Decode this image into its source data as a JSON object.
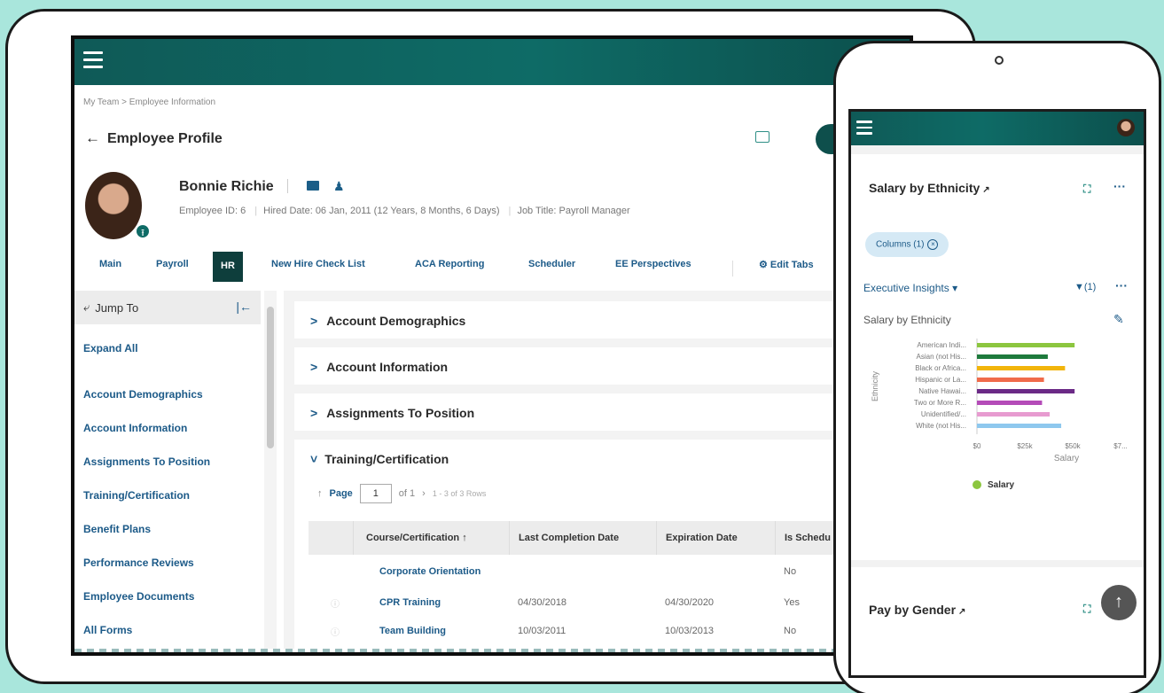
{
  "breadcrumb": "My Team  >  Employee Information",
  "page_title": "Employee Profile",
  "employee": {
    "name": "Bonnie Richie",
    "id": "Employee ID: 6",
    "hired": "Hired Date: 06 Jan, 2011 (12 Years, 8 Months, 6 Days)",
    "job": "Job Title: Payroll Manager"
  },
  "tabs": [
    "Main",
    "Payroll",
    "HR",
    "New Hire Check List",
    "ACA Reporting",
    "Scheduler",
    "EE Perspectives"
  ],
  "edit_tabs": "Edit Tabs",
  "sidebar": {
    "title": "Jump To",
    "expand_all": "Expand All",
    "items": [
      "Account Demographics",
      "Account Information",
      "Assignments To Position",
      "Training/Certification",
      "Benefit Plans",
      "Performance Reviews",
      "Employee Documents",
      "All Forms"
    ]
  },
  "sections": [
    "Account Demographics",
    "Account Information",
    "Assignments To Position"
  ],
  "training": {
    "title": "Training/Certification",
    "page_label": "Page",
    "page_value": "1",
    "of": "of 1",
    "rows_info": "1 - 3 of 3 Rows",
    "columns": [
      "Course/Certification",
      "Last Completion Date",
      "Expiration Date",
      "Is Schedu"
    ],
    "rows": [
      {
        "course": "Corporate Orientation",
        "last": "",
        "exp": "",
        "sched": "No"
      },
      {
        "course": "CPR Training",
        "last": "04/30/2018",
        "exp": "04/30/2020",
        "sched": "Yes"
      },
      {
        "course": "Team Building",
        "last": "10/03/2011",
        "exp": "10/03/2013",
        "sched": "No"
      }
    ]
  },
  "phone": {
    "card_title": "Salary by Ethnicity",
    "chip": "Columns (1)",
    "view": "Executive Insights",
    "filter": "(1)",
    "subtitle": "Salary by Ethnicity",
    "footer_title": "Pay by Gender"
  },
  "chart_data": {
    "type": "bar",
    "orientation": "horizontal",
    "categories": [
      "American Indi...",
      "Asian (not His...",
      "Black or Africa...",
      "Hispanic or La...",
      "Native Hawai...",
      "Two or More R...",
      "Unidentified/...",
      "White (not His..."
    ],
    "values": [
      51000,
      37000,
      46000,
      35000,
      51000,
      34000,
      38000,
      44000
    ],
    "colors": [
      "#8cc63f",
      "#1e7a3c",
      "#f2b50a",
      "#f06b4b",
      "#6b2a86",
      "#b44bb8",
      "#e79bd0",
      "#8ec8ee"
    ],
    "xticks": [
      "$0",
      "$25k",
      "$50k",
      "$7..."
    ],
    "xlim": [
      0,
      75000
    ],
    "xlabel": "Salary",
    "ylabel": "Ethnicity",
    "legend": [
      {
        "name": "Salary",
        "color": "#8cc63f"
      }
    ]
  }
}
